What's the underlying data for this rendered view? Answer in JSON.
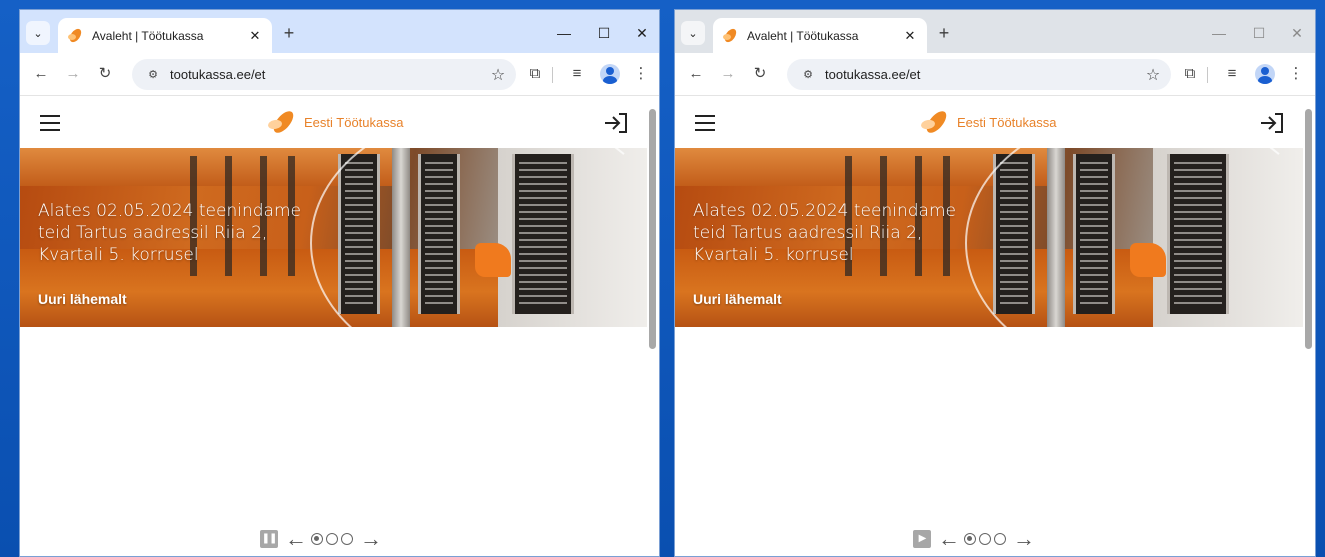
{
  "windows": [
    {
      "tab": {
        "title": "Avaleht | Töötukassa",
        "close": "✕"
      },
      "new_tab": "+",
      "controls": {
        "minimize": "—",
        "maximize": "☐",
        "close": "✕"
      },
      "toolbar": {
        "url": "tootukassa.ee/et"
      },
      "site": {
        "logo_text": "Eesti Töötukassa",
        "hero": {
          "title": "Alates 02.05.2024 teenindame teid Tartus aadressil Riia 2, Kvartali 5. korrusel",
          "link": "Uuri lähemalt"
        },
        "carousel": {
          "state": "playing",
          "toggle_glyph": "❚❚",
          "dots": 3,
          "active_dot": 0
        }
      }
    },
    {
      "tab": {
        "title": "Avaleht | Töötukassa",
        "close": "✕"
      },
      "new_tab": "+",
      "controls": {
        "minimize": "—",
        "maximize": "☐",
        "close": "✕"
      },
      "toolbar": {
        "url": "tootukassa.ee/et"
      },
      "site": {
        "logo_text": "Eesti Töötukassa",
        "hero": {
          "title": "Alates 02.05.2024 teenindame teid Tartus aadressil Riia 2, Kvartali 5. korrusel",
          "link": "Uuri lähemalt"
        },
        "carousel": {
          "state": "paused",
          "toggle_glyph": "▶",
          "dots": 3,
          "active_dot": 0
        }
      }
    }
  ],
  "colors": {
    "brand": "#e8822a",
    "active_tabstrip": "#d3e3fd",
    "inactive_tabstrip": "#dfe3e8"
  },
  "icons": [
    "tab-search-icon",
    "back-icon",
    "forward-icon",
    "reload-icon",
    "site-settings-icon",
    "star-icon",
    "extensions-icon",
    "reading-list-icon",
    "profile-icon",
    "menu-icon",
    "hamburger-icon",
    "login-icon",
    "pause-icon",
    "play-icon",
    "arrow-left-icon",
    "arrow-right-icon"
  ]
}
